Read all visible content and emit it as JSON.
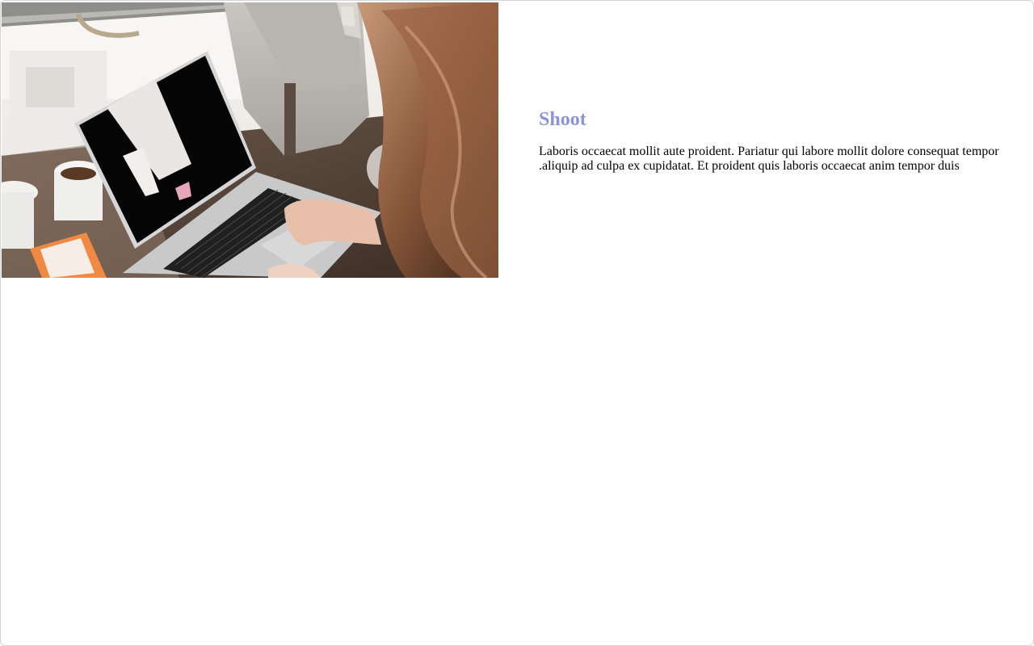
{
  "card": {
    "title": "Shoot",
    "title_color": "#8b93db",
    "body": "Laboris occaecat mollit aute proident. Pariatur qui labore mollit dolore consequat tempor .aliquip ad culpa ex cupidatat. Et proident quis laboris occaecat anim tempor duis",
    "image_subject": "person typing on laptop at a cafe table"
  }
}
